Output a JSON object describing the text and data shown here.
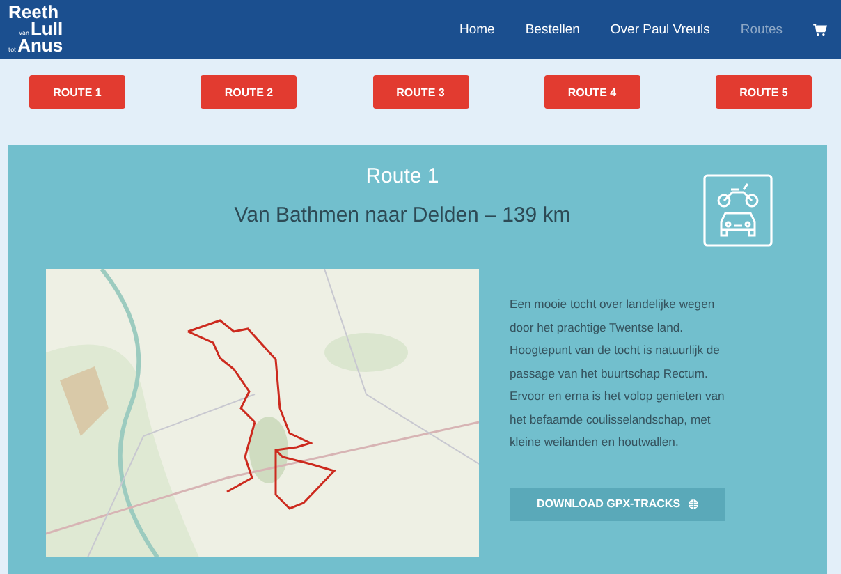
{
  "logo": {
    "lines": [
      {
        "big": "Reeth"
      },
      {
        "small": "van",
        "big": "Lull"
      },
      {
        "small": "tot",
        "big": "Anus"
      }
    ]
  },
  "nav": [
    {
      "label": "Home",
      "selected": false
    },
    {
      "label": "Bestellen",
      "selected": false
    },
    {
      "label": "Over Paul Vreuls",
      "selected": false
    },
    {
      "label": "Routes",
      "selected": true
    }
  ],
  "route_buttons": [
    "ROUTE 1",
    "ROUTE 2",
    "ROUTE 3",
    "ROUTE 4",
    "ROUTE 5"
  ],
  "route": {
    "title": "Route 1",
    "subtitle": "Van Bathmen naar Delden – 139 km",
    "description": "Een mooie tocht over landelijke wegen door het prachtige Twentse land. Hoogtepunt van de tocht is natuurlijk de passage van het buurtschap Rectum. Ervoor en erna is het volop genieten van het befaamde coulisselandschap, met kleine weilanden en houtwallen.",
    "download_button": "DOWNLOAD GPX-TRACKS"
  }
}
